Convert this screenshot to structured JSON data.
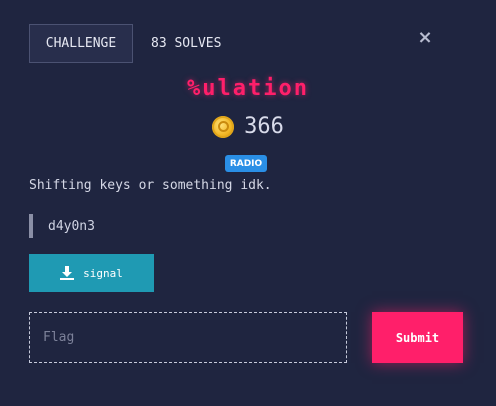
{
  "tabs": {
    "challenge_label": "CHALLENGE",
    "solves_label": "83 SOLVES"
  },
  "close_icon": "×",
  "challenge": {
    "title": "%ulation",
    "points": "366",
    "category_badge": "RADIO",
    "description": "Shifting keys or something idk.",
    "author": "d4y0n3"
  },
  "download": {
    "label": "signal",
    "icon": "download-icon"
  },
  "flag": {
    "placeholder": "Flag",
    "value": ""
  },
  "submit_label": "Submit",
  "colors": {
    "background": "#1f2540",
    "accent": "#ff1f6a",
    "download": "#1f9ab3",
    "badge": "#2a8fe6"
  }
}
